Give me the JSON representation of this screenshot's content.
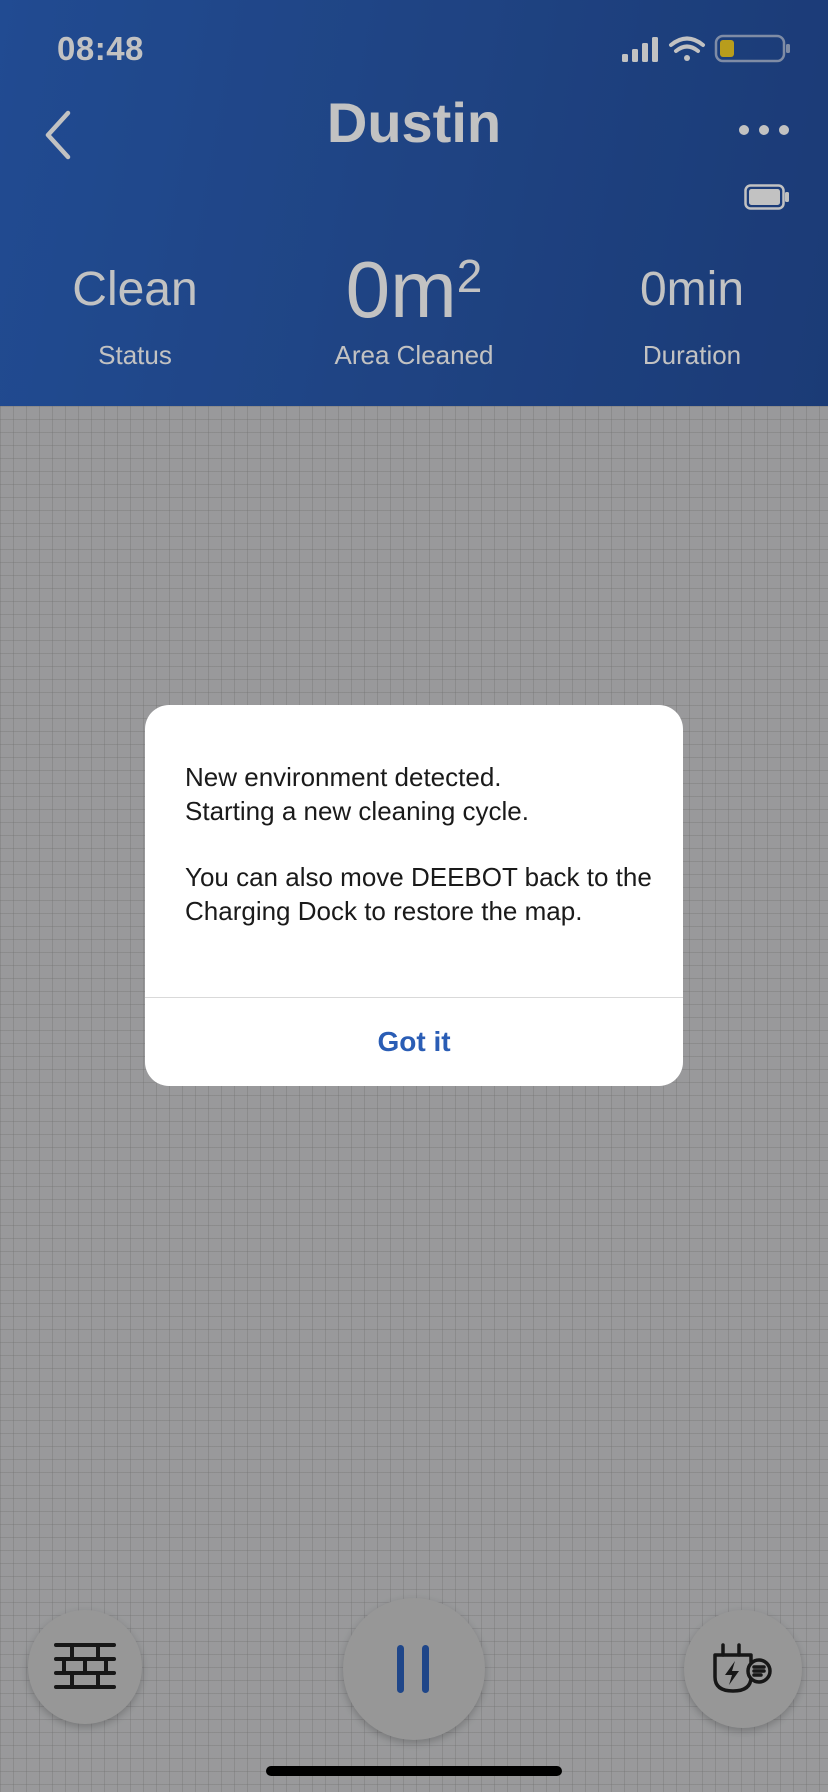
{
  "status_bar": {
    "time": "08:48"
  },
  "header": {
    "title": "Dustin"
  },
  "stats": {
    "status": {
      "value": "Clean",
      "label": "Status"
    },
    "area": {
      "value": "0m",
      "unit_sup": "2",
      "label": "Area Cleaned"
    },
    "duration": {
      "value": "0min",
      "label": "Duration"
    }
  },
  "dialog": {
    "line1": "New environment detected.",
    "line2": "Starting a new cleaning cycle.",
    "line3": "You can also move DEEBOT back to the Charging Dock to restore the map.",
    "button_label": "Got it"
  },
  "bottom_bar": {
    "icons": [
      "map-wall-icon",
      "pause-icon",
      "charge-dock-icon"
    ]
  },
  "colors": {
    "header_blue": "#2a5aae",
    "accent": "#2a5db5",
    "phone_battery_level": "#f2cf25"
  },
  "phone_battery_level": 0.22
}
